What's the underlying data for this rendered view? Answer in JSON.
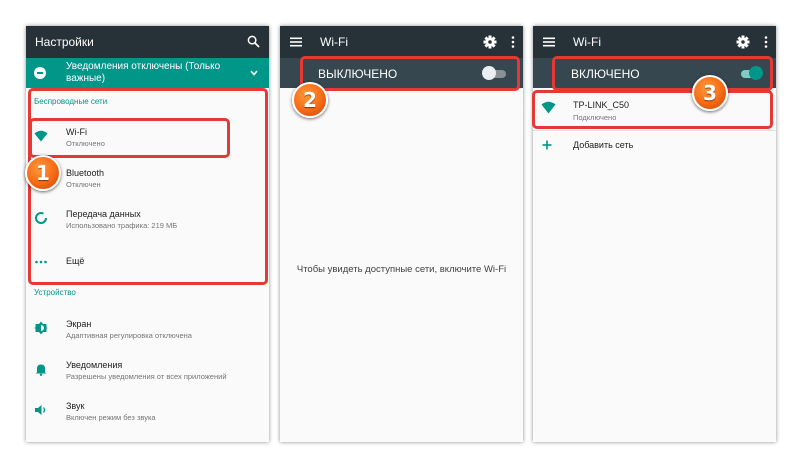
{
  "colors": {
    "toolbar": "#263238",
    "switch_bar": "#37474f",
    "accent_teal": "#009688",
    "highlight_red": "#e53935",
    "badge_orange": "#f56a14"
  },
  "screen1": {
    "title": "Настройки",
    "banner": "Уведомления отключены (Только важные)",
    "sections": {
      "wireless": "Беспроводные сети",
      "device": "Устройство"
    },
    "items": {
      "wifi": {
        "title": "Wi-Fi",
        "subtitle": "Отключено",
        "icon": "wifi-icon"
      },
      "bluetooth": {
        "title": "Bluetooth",
        "subtitle": "Отключен",
        "icon": "bluetooth-icon"
      },
      "data": {
        "title": "Передача данных",
        "subtitle": "Использовано трафика: 219 МБ",
        "icon": "data-usage-icon"
      },
      "more": {
        "title": "Ещё",
        "icon": "more-horizontal-icon"
      },
      "display": {
        "title": "Экран",
        "subtitle": "Адаптивная регулировка отключена",
        "icon": "brightness-icon"
      },
      "notifications": {
        "title": "Уведомления",
        "subtitle": "Разрешены уведомления от всех приложений",
        "icon": "bell-icon"
      },
      "sound": {
        "title": "Звук",
        "subtitle": "Включен режим без звука",
        "icon": "speaker-icon"
      }
    }
  },
  "screen2": {
    "title": "Wi-Fi",
    "switch_label": "ВЫКЛЮЧЕНО",
    "switch_on": false,
    "empty_message": "Чтобы увидеть доступные сети, включите Wi-Fi"
  },
  "screen3": {
    "title": "Wi-Fi",
    "switch_label": "ВКЛЮЧЕНО",
    "switch_on": true,
    "network": {
      "ssid": "TP-LINK_C50",
      "status": "Подключено"
    },
    "add_network": "Добавить сеть"
  },
  "badges": [
    "1",
    "2",
    "3"
  ]
}
